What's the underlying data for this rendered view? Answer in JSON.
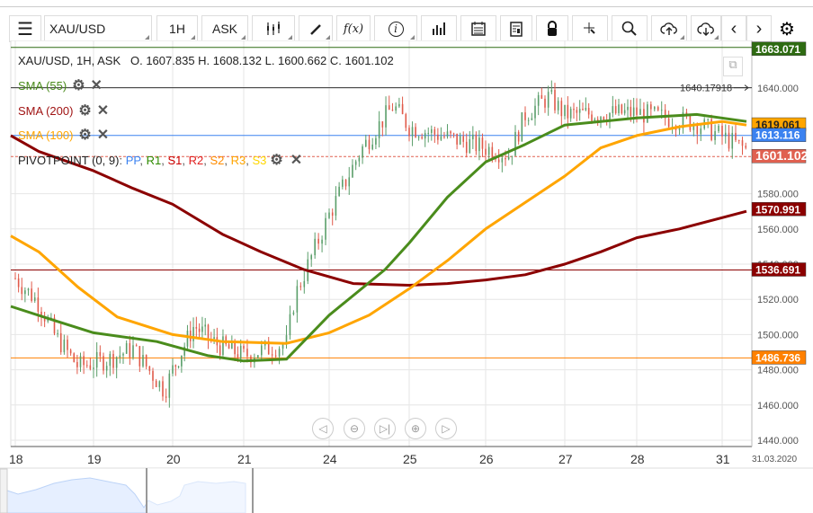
{
  "toolbar": {
    "symbol": "XAU/USD",
    "timeframe": "1H",
    "price_type": "ASK"
  },
  "header": {
    "ohlc": "XAU/USD, 1H, ASK   O. 1607.835 H. 1608.132 L. 1600.662 C. 1601.102"
  },
  "indicators": [
    {
      "label": "SMA (55)",
      "color": "#4a8c1c"
    },
    {
      "label": "SMA (200)",
      "color": "#a01414"
    },
    {
      "label": "SMA (100)",
      "color": "#ffa500"
    }
  ],
  "pivot": {
    "label": "PIVOTPOINT (0, 9)",
    "parts": [
      " : ",
      "PP",
      ", ",
      "R1",
      ", ",
      "S1",
      ", ",
      "R2",
      ", ",
      "S2",
      ", ",
      "R3",
      ", ",
      "S3"
    ]
  },
  "y_axis": {
    "ticks": [
      1640,
      1580,
      1560,
      1540,
      1520,
      1500,
      1480,
      1460,
      1440
    ],
    "tick_labels": [
      "1640.000",
      "1580.000",
      "1560.000",
      "1540.000",
      "1520.000",
      "1500.000",
      "1480.000",
      "1460.000",
      "1440.000"
    ]
  },
  "x_axis": {
    "labels": [
      "18",
      "19",
      "20",
      "21",
      "24",
      "25",
      "26",
      "27",
      "28",
      "31"
    ],
    "date": "31.03.2020"
  },
  "levels": [
    {
      "value": 1663.071,
      "label": "1663.071",
      "color": "#2e6b12",
      "style": "solid"
    },
    {
      "value": 1640.17918,
      "label": "1640.17918",
      "color": "#333333",
      "style": "solid"
    },
    {
      "value": 1619.061,
      "label": "1619.061",
      "color": "#ffa500",
      "style": "none"
    },
    {
      "value": 1613.116,
      "label": "1613.116",
      "color": "#3b82f0",
      "style": "solid"
    },
    {
      "value": 1601.102,
      "label": "1601.102",
      "color": "#e06050",
      "style": "dashed"
    },
    {
      "value": 1570.991,
      "label": "1570.991",
      "color": "#8b0000",
      "style": "none"
    },
    {
      "value": 1536.691,
      "label": "1536.691",
      "color": "#8b0000",
      "style": "solid"
    },
    {
      "value": 1486.736,
      "label": "1486.736",
      "color": "#ff8000",
      "style": "solid"
    }
  ],
  "price_path": [
    [
      0,
      1532
    ],
    [
      0.3,
      1518
    ],
    [
      0.5,
      1500
    ],
    [
      0.8,
      1482
    ],
    [
      1.2,
      1486
    ],
    [
      1.5,
      1492
    ],
    [
      1.9,
      1468
    ],
    [
      2.0,
      1480
    ],
    [
      2.3,
      1505
    ],
    [
      2.6,
      1495
    ],
    [
      3.0,
      1488
    ],
    [
      3.5,
      1495
    ],
    [
      3.6,
      1522
    ],
    [
      4.0,
      1568
    ],
    [
      4.4,
      1605
    ],
    [
      4.8,
      1630
    ],
    [
      5.0,
      1618
    ],
    [
      5.5,
      1612
    ],
    [
      6.0,
      1606
    ],
    [
      6.3,
      1602
    ],
    [
      6.5,
      1625
    ],
    [
      6.8,
      1635
    ],
    [
      7.0,
      1625
    ],
    [
      8.0,
      1626
    ],
    [
      8.7,
      1620
    ],
    [
      9.3,
      1605
    ]
  ],
  "sma55": [
    [
      -0.1,
      1516
    ],
    [
      0.5,
      1508
    ],
    [
      1,
      1501
    ],
    [
      1.8,
      1496
    ],
    [
      2.5,
      1488
    ],
    [
      3,
      1485
    ],
    [
      3.5,
      1486
    ],
    [
      4,
      1511
    ],
    [
      4.7,
      1537
    ],
    [
      5,
      1552
    ],
    [
      5.5,
      1578
    ],
    [
      6,
      1598
    ],
    [
      6.5,
      1608
    ],
    [
      7,
      1619
    ],
    [
      7.5,
      1621
    ],
    [
      8,
      1623
    ],
    [
      8.7,
      1625
    ],
    [
      9.3,
      1621
    ]
  ],
  "sma100": [
    [
      -0.1,
      1556
    ],
    [
      0.3,
      1547
    ],
    [
      0.8,
      1527
    ],
    [
      1.3,
      1510
    ],
    [
      2,
      1500
    ],
    [
      2.7,
      1496
    ],
    [
      3.5,
      1495
    ],
    [
      4,
      1501
    ],
    [
      4.5,
      1511
    ],
    [
      5,
      1526
    ],
    [
      5.5,
      1542
    ],
    [
      6,
      1560
    ],
    [
      6.5,
      1575
    ],
    [
      7,
      1590
    ],
    [
      7.5,
      1606
    ],
    [
      8,
      1613
    ],
    [
      8.5,
      1618
    ],
    [
      9,
      1621
    ],
    [
      9.3,
      1619
    ]
  ],
  "sma200": [
    [
      -0.1,
      1613
    ],
    [
      0.3,
      1604
    ],
    [
      1,
      1593
    ],
    [
      1.5,
      1583
    ],
    [
      2,
      1574
    ],
    [
      2.7,
      1557
    ],
    [
      3.2,
      1547
    ],
    [
      3.7,
      1537
    ],
    [
      4.3,
      1529
    ],
    [
      5,
      1528
    ],
    [
      5.5,
      1529
    ],
    [
      6,
      1531
    ],
    [
      6.5,
      1534
    ],
    [
      7,
      1540
    ],
    [
      7.5,
      1547
    ],
    [
      8,
      1555
    ],
    [
      8.5,
      1560
    ],
    [
      9.3,
      1570
    ]
  ]
}
